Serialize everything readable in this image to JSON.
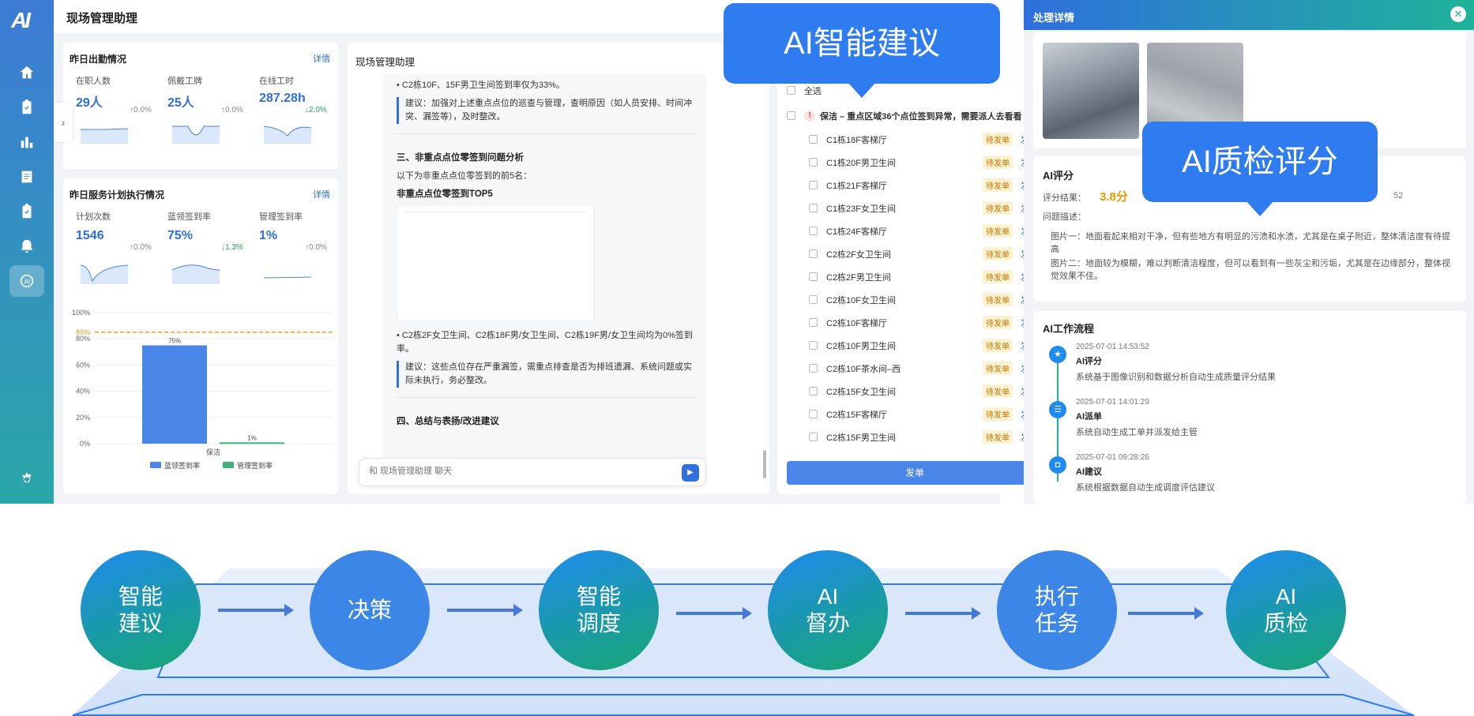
{
  "app": {
    "logo": "AI",
    "title": "现场管理助理"
  },
  "attendance": {
    "title": "昨日出勤情况",
    "link": "详情",
    "metrics": [
      {
        "label": "在职人数",
        "value": "29人",
        "delta": "↑0.0%"
      },
      {
        "label": "佩戴工牌",
        "value": "25人",
        "delta": "↑0.0%"
      },
      {
        "label": "在线工时",
        "value": "287.28h",
        "delta": "↓2.0%"
      }
    ]
  },
  "service": {
    "title": "昨日服务计划执行情况",
    "link": "详情",
    "metrics": [
      {
        "label": "计划次数",
        "value": "1546",
        "delta": "↑0.0%"
      },
      {
        "label": "蓝领签到率",
        "value": "75%",
        "delta": "↓1.3%"
      },
      {
        "label": "管理签到率",
        "value": "1%",
        "delta": "↑0.0%"
      }
    ]
  },
  "chart_data": {
    "type": "bar",
    "categories": [
      "保洁"
    ],
    "series": [
      {
        "name": "蓝领签到率",
        "values": [
          75
        ],
        "color": "#4a85e8"
      },
      {
        "name": "管理签到率",
        "values": [
          1
        ],
        "color": "#3fb27a"
      }
    ],
    "yticks": [
      "100%",
      "80%",
      "60%",
      "40%",
      "20%",
      "0%"
    ],
    "ylim": [
      0,
      100
    ],
    "threshold": {
      "label": "85%",
      "value": 85,
      "color": "#f0a020"
    },
    "data_labels": [
      "75%",
      "1%"
    ],
    "legend_position": "bottom"
  },
  "chat": {
    "title": "现场管理助理",
    "line1": "C2栋10F、15F男卫生间签到率仅为33%。",
    "sug1": "建议：加强对上述重点点位的巡查与管理，查明原因（如人员安排、时间冲突、漏签等），及时整改。",
    "sec3": "三、非重点点位零签到问题分析",
    "sec3_desc": "以下为非重点点位零签到的前5名：",
    "top5": "非重点点位零签到TOP5",
    "line2": "C2栋2F女卫生间、C2栋18F男/女卫生间、C2栋19F男/女卫生间均为0%签到率。",
    "sug2": "建议：这些点位存在严重漏签，需重点排查是否为排班遗漏、系统问题或实际未执行，务必整改。",
    "sec4": "四、总结与表扬/改进建议",
    "input_placeholder": "和 现场管理助理 聊天"
  },
  "tasks": {
    "select_all": "全选",
    "group": "保洁 – 重点区域36个点位签到异常，需要派人去看看",
    "tag": "待发单",
    "action": "发单",
    "items": [
      "C1栋18F客梯厅",
      "C1栋20F男卫生间",
      "C1栋21F客梯厅",
      "C1栋23F女卫生间",
      "C1栋24F客梯厅",
      "C2栋2F女卫生间",
      "C2栋2F男卫生间",
      "C2栋10F女卫生间",
      "C2栋10F客梯厅",
      "C2栋10F男卫生间",
      "C2栋10F茶水间–西",
      "C2栋15F女卫生间",
      "C2栋15F客梯厅",
      "C2栋15F男卫生间"
    ],
    "submit": "发单"
  },
  "detail": {
    "header": "处理详情",
    "ai_score_title": "AI评分",
    "score_label": "评分结果：",
    "score": "3.8分",
    "score_time": "52",
    "desc_label": "问题描述：",
    "desc1": "图片一：地面看起来相对干净，但有些地方有明显的污渍和水渍，尤其是在桌子附近，整体清洁度有待提高",
    "desc2": "图片二：地面较为模糊，难以判断清洁程度，但可以看到有一些灰尘和污垢，尤其是在边缘部分，整体视觉效果不佳。",
    "flow_title": "AI工作流程",
    "steps": [
      {
        "time": "2025-07-01 14:53:52",
        "name": "AI评分",
        "desc": "系统基于图像识别和数据分析自动生成质量评分结果"
      },
      {
        "time": "2025-07-01 14:01:29",
        "name": "AI派单",
        "desc": "系统自动生成工单并派发给主管"
      },
      {
        "time": "2025-07-01 09:28:26",
        "name": "AI建议",
        "desc": "系统根据数据自动生成调度评估建议"
      }
    ]
  },
  "callouts": {
    "suggest": "AI智能建议",
    "qc": "AI质检评分"
  },
  "flow": [
    {
      "l1": "智能",
      "l2": "建议"
    },
    {
      "l1": "决策",
      "l2": ""
    },
    {
      "l1": "智能",
      "l2": "调度"
    },
    {
      "l1": "AI",
      "l2": "督办"
    },
    {
      "l1": "执行",
      "l2": "任务"
    },
    {
      "l1": "AI",
      "l2": "质检"
    }
  ]
}
